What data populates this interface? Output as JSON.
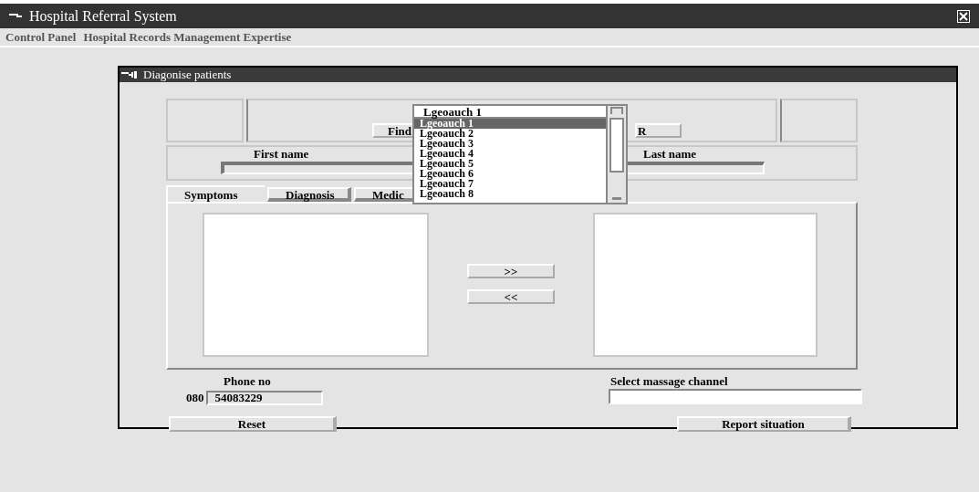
{
  "window": {
    "title": "Hospital Referral System"
  },
  "menu": [
    "Control Panel",
    "Hospital Records Management Expertise"
  ],
  "dialog": {
    "title": "Diagonise patients",
    "find_button": "Find",
    "r_button": "R",
    "combo": {
      "value": "Lgeoauch 1",
      "options": [
        {
          "label": "Lgeoauch 1",
          "selected": true
        },
        {
          "label": "Lgeoauch 2",
          "selected": false
        },
        {
          "label": "Lgeoauch 3",
          "selected": false
        },
        {
          "label": "Lgeoauch 4",
          "selected": false
        },
        {
          "label": "Lgeoauch 5",
          "selected": false
        },
        {
          "label": "Lgeoauch 6",
          "selected": false
        },
        {
          "label": "Lgeoauch 7",
          "selected": false
        },
        {
          "label": "Lgeoauch 8",
          "selected": false
        }
      ]
    },
    "first_name": {
      "label": "First name"
    },
    "last_name": {
      "label": "Last name"
    },
    "tabs": [
      {
        "label": "Symptoms",
        "selected": true
      },
      {
        "label": "Diagnosis",
        "selected": false
      },
      {
        "label": "Medic",
        "selected": false
      }
    ],
    "move_buttons": [
      ">>",
      "<<"
    ],
    "phone": {
      "label": "Phone no",
      "prefix": "080",
      "value": "54083229"
    },
    "channel": {
      "label": "Select massage channel"
    },
    "reset_button": "Reset",
    "report_button": "Report situation"
  }
}
